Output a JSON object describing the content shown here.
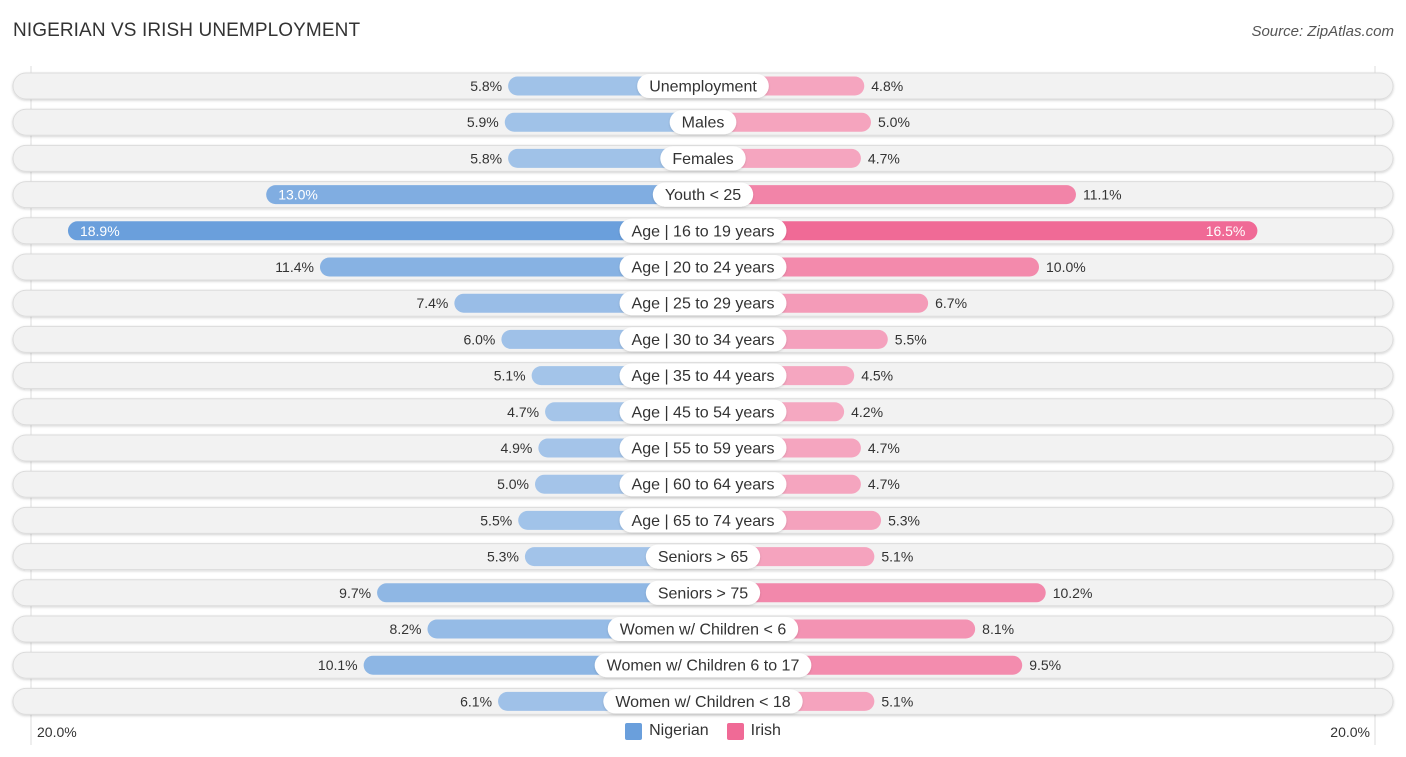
{
  "header": {
    "title": "NIGERIAN VS IRISH UNEMPLOYMENT",
    "source": "Source: ZipAtlas.com"
  },
  "colors": {
    "nigerian": "#6a9fdc",
    "nigerian_light": "#a8c7ea",
    "irish": "#f06a96",
    "irish_light": "#f5a9c2",
    "track": "#f2f2f2"
  },
  "chart_data": {
    "type": "bar",
    "orientation": "horizontal-diverging",
    "title": "NIGERIAN VS IRISH UNEMPLOYMENT",
    "xlabel": "",
    "ylabel": "",
    "xlim": [
      -20.0,
      20.0
    ],
    "axis_labels": {
      "left": "20.0%",
      "right": "20.0%"
    },
    "legend_position": "bottom-center",
    "grid": false,
    "categories": [
      "Unemployment",
      "Males",
      "Females",
      "Youth < 25",
      "Age | 16 to 19 years",
      "Age | 20 to 24 years",
      "Age | 25 to 29 years",
      "Age | 30 to 34 years",
      "Age | 35 to 44 years",
      "Age | 45 to 54 years",
      "Age | 55 to 59 years",
      "Age | 60 to 64 years",
      "Age | 65 to 74 years",
      "Seniors > 65",
      "Seniors > 75",
      "Women w/ Children < 6",
      "Women w/ Children 6 to 17",
      "Women w/ Children < 18"
    ],
    "series": [
      {
        "name": "Nigerian",
        "side": "left",
        "values": [
          5.8,
          5.9,
          5.8,
          13.0,
          18.9,
          11.4,
          7.4,
          6.0,
          5.1,
          4.7,
          4.9,
          5.0,
          5.5,
          5.3,
          9.7,
          8.2,
          10.1,
          6.1
        ],
        "labels": [
          "5.8%",
          "5.9%",
          "5.8%",
          "13.0%",
          "18.9%",
          "11.4%",
          "7.4%",
          "6.0%",
          "5.1%",
          "4.7%",
          "4.9%",
          "5.0%",
          "5.5%",
          "5.3%",
          "9.7%",
          "8.2%",
          "10.1%",
          "6.1%"
        ]
      },
      {
        "name": "Irish",
        "side": "right",
        "values": [
          4.8,
          5.0,
          4.7,
          11.1,
          16.5,
          10.0,
          6.7,
          5.5,
          4.5,
          4.2,
          4.7,
          4.7,
          5.3,
          5.1,
          10.2,
          8.1,
          9.5,
          5.1
        ],
        "labels": [
          "4.8%",
          "5.0%",
          "4.7%",
          "11.1%",
          "16.5%",
          "10.0%",
          "6.7%",
          "5.5%",
          "4.5%",
          "4.2%",
          "4.7%",
          "4.7%",
          "5.3%",
          "5.1%",
          "10.2%",
          "8.1%",
          "9.5%",
          "5.1%"
        ]
      }
    ]
  },
  "legend": [
    {
      "name": "Nigerian",
      "color": "#6a9fdc"
    },
    {
      "name": "Irish",
      "color": "#f06a96"
    }
  ]
}
